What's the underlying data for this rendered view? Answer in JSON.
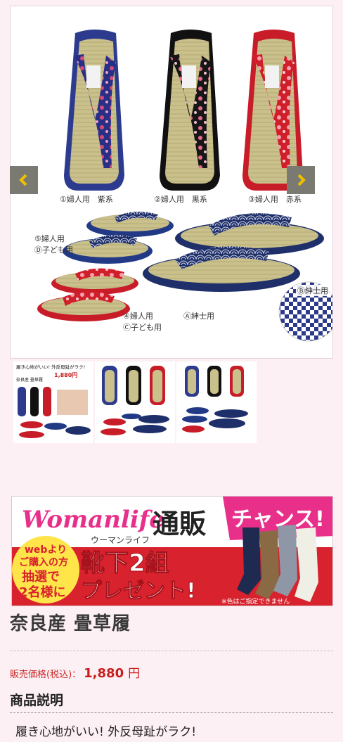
{
  "main_image": {
    "captions": {
      "c1": "①婦人用　紫系",
      "c2": "②婦人用　黒系",
      "c3": "③婦人用　赤系",
      "c5a": "⑤婦人用",
      "c5b": "Ⓓ子ども用",
      "c4a": "④婦人用",
      "c4b": "Ⓒ子ども用",
      "cA": "Ⓐ紳士用",
      "cB": "Ⓑ紳士用"
    }
  },
  "carousel": {
    "prev_icon": "chevron-left-icon",
    "next_icon": "chevron-right-icon"
  },
  "thumbnails": {
    "t1_headline": "履き心地がいい! 外反母趾がラク!",
    "t1_product": "奈良産 畳草履",
    "t1_price": "1,880円"
  },
  "banner": {
    "brand": "Womanlife",
    "brand_kana": "ウーマンライフ",
    "tsuhan": "通販",
    "chance": "チャンス!",
    "web_line1": "webより",
    "web_line2": "ご購入の方",
    "web_line3": "抽選で",
    "web_line4": "2名様に",
    "gift_line1": "靴下2組",
    "gift_line2": "プレゼント!",
    "note": "※色はご指定できません"
  },
  "product": {
    "title": "奈良産 畳草履",
    "price_label": "販売価格(税込)：",
    "price_value": "1,880",
    "price_unit": "円",
    "section_heading": "商品説明",
    "description": "履き心地がいい! 外反母趾がラク!"
  },
  "colors": {
    "price_red": "#c81e1e",
    "arrow_bg": "#7a7a72",
    "arrow_fg": "#f0c000",
    "banner_red": "#d8222d",
    "banner_pink": "#e8308a",
    "background": "#fdf0f4"
  }
}
